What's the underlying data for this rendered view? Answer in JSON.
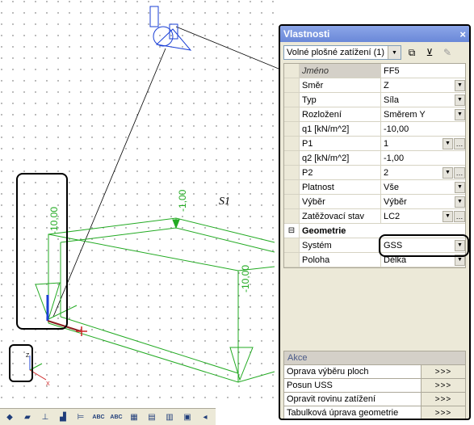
{
  "viewport": {
    "labels": {
      "s1": "S1",
      "val_left": "-10,00",
      "val_top": "-1,00",
      "val_right": "-10,00"
    },
    "axis": {
      "z": "Z",
      "x": "X"
    }
  },
  "toolbar": {
    "buttons": [
      {
        "name": "render-icon"
      },
      {
        "name": "surface-icon"
      },
      {
        "name": "axis-icon"
      },
      {
        "name": "chart-icon"
      },
      {
        "name": "chart2-icon"
      },
      {
        "label": "ABC"
      },
      {
        "label": "ABC"
      },
      {
        "name": "grid-icon"
      },
      {
        "name": "table-icon"
      },
      {
        "name": "table2-icon"
      },
      {
        "name": "layers-icon"
      },
      {
        "name": "layers2-icon"
      }
    ]
  },
  "panel": {
    "title": "Vlastnosti",
    "close": "×",
    "filter": {
      "value": "Volné plošné zatížení (1)"
    },
    "rows": [
      {
        "label": "Jméno",
        "value": "FF5",
        "type": "text",
        "selected": true
      },
      {
        "label": "Směr",
        "value": "Z",
        "type": "dropdown"
      },
      {
        "label": "Typ",
        "value": "Síla",
        "type": "dropdown"
      },
      {
        "label": "Rozložení",
        "value": "Směrem Y",
        "type": "dropdown"
      },
      {
        "label": "q1 [kN/m^2]",
        "value": "-10,00",
        "type": "text"
      },
      {
        "label": "P1",
        "value": "1",
        "type": "dropdown-dots"
      },
      {
        "label": "q2 [kN/m^2]",
        "value": "-1,00",
        "type": "text"
      },
      {
        "label": "P2",
        "value": "2",
        "type": "dropdown-dots"
      },
      {
        "label": "Platnost",
        "value": "Vše",
        "type": "dropdown"
      },
      {
        "label": "Výběr",
        "value": "Výběr",
        "type": "dropdown"
      },
      {
        "label": "Zatěžovací stav",
        "value": "LC2",
        "type": "dropdown-dots"
      }
    ],
    "group": {
      "label": "Geometrie",
      "toggle": "⊟"
    },
    "geo_rows": [
      {
        "label": "Systém",
        "value": "GSS",
        "type": "dropdown"
      },
      {
        "label": "Poloha",
        "value": "Délka",
        "type": "dropdown"
      }
    ],
    "akce": {
      "title": "Akce",
      "items": [
        {
          "label": "Oprava výběru ploch",
          "button": ">>>"
        },
        {
          "label": "Posun USS",
          "button": ">>>"
        },
        {
          "label": "Opravit rovinu zatížení",
          "button": ">>>"
        },
        {
          "label": "Tabulková úprava geometrie",
          "button": ">>>"
        }
      ]
    }
  },
  "colors": {
    "model": "#22aa22",
    "accent": "#1a3fd6",
    "highlight": "#000000"
  }
}
